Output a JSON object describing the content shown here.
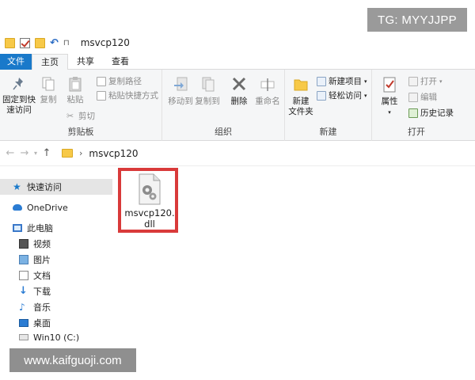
{
  "watermarks": {
    "top": "TG: MYYJJPP",
    "bottom": "www.kaifguoji.com"
  },
  "window": {
    "title": "msvcp120"
  },
  "tabs": [
    {
      "label": "文件"
    },
    {
      "label": "主页"
    },
    {
      "label": "共享"
    },
    {
      "label": "查看"
    }
  ],
  "ribbon": {
    "clipboard": {
      "group_label": "剪贴板",
      "pin_label_1": "固定到快",
      "pin_label_2": "速访问",
      "copy_label": "复制",
      "paste_label": "粘贴",
      "copy_path_label": "复制路径",
      "paste_shortcut_label": "粘贴快捷方式",
      "cut_label": "剪切"
    },
    "organize": {
      "group_label": "组织",
      "move_to_label": "移动到",
      "copy_to_label": "复制到",
      "delete_label": "删除",
      "rename_label": "重命名"
    },
    "new": {
      "group_label": "新建",
      "new_folder_label_1": "新建",
      "new_folder_label_2": "文件夹",
      "new_item_label": "新建项目",
      "easy_access_label": "轻松访问"
    },
    "open": {
      "group_label": "打开",
      "properties_label": "属性",
      "open_label": "打开",
      "edit_label": "编辑",
      "history_label": "历史记录"
    }
  },
  "address": {
    "path": "msvcp120"
  },
  "nav": {
    "items": [
      {
        "label": "快速访问"
      },
      {
        "label": "OneDrive"
      },
      {
        "label": "此电脑"
      },
      {
        "label": "视频"
      },
      {
        "label": "图片"
      },
      {
        "label": "文档"
      },
      {
        "label": "下载"
      },
      {
        "label": "音乐"
      },
      {
        "label": "桌面"
      },
      {
        "label": "Win10 (C:)"
      }
    ]
  },
  "files": [
    {
      "name_line1": "msvcp120.",
      "name_line2": "dll"
    }
  ],
  "colors": {
    "accent": "#1979ca",
    "selection_outline": "#d93a3a",
    "folder": "#f7c948"
  }
}
